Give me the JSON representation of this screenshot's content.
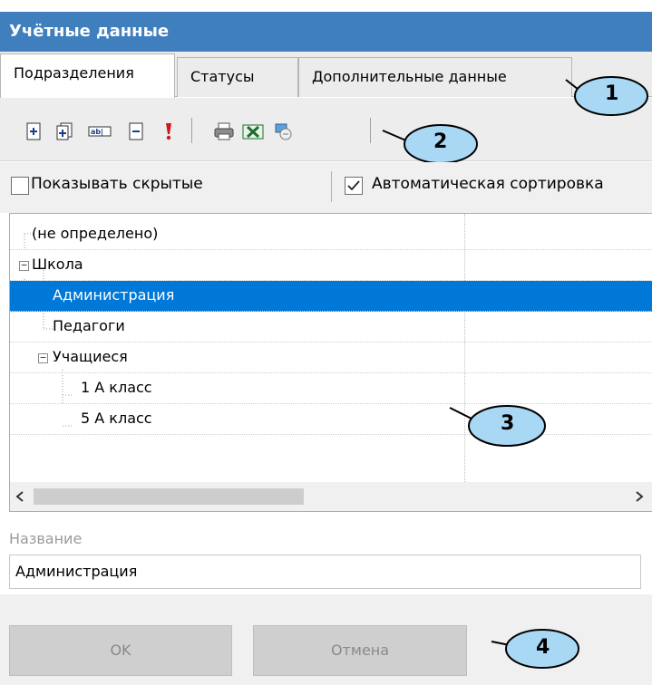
{
  "window": {
    "title": "Учётные данные"
  },
  "tabs": [
    {
      "label": "Подразделения",
      "active": true
    },
    {
      "label": "Статусы",
      "active": false
    },
    {
      "label": "Дополнительные данные",
      "active": false
    }
  ],
  "toolbar": {
    "icons": [
      "add-icon",
      "add-child-icon",
      "rename-icon",
      "delete-icon",
      "alert-icon",
      "print-icon",
      "excel-export-icon",
      "import-icon"
    ]
  },
  "options": {
    "show_hidden_label": "Показывать скрытые",
    "show_hidden_checked": false,
    "auto_sort_label": "Автоматическая сортировка",
    "auto_sort_checked": true
  },
  "tree": {
    "rows": [
      {
        "label": "(не определено)",
        "level": 0,
        "expandable": false,
        "selected": false
      },
      {
        "label": "Школа",
        "level": 0,
        "expandable": true,
        "selected": false
      },
      {
        "label": "Администрация",
        "level": 1,
        "expandable": false,
        "selected": true
      },
      {
        "label": "Педагоги",
        "level": 1,
        "expandable": false,
        "selected": false
      },
      {
        "label": "Учащиеся",
        "level": 1,
        "expandable": true,
        "selected": false
      },
      {
        "label": "1 А класс",
        "level": 2,
        "expandable": false,
        "selected": false
      },
      {
        "label": "5 А класс",
        "level": 2,
        "expandable": false,
        "selected": false
      }
    ]
  },
  "name_field": {
    "label": "Название",
    "value": "Администрация"
  },
  "buttons": {
    "ok": "OK",
    "cancel": "Отмена"
  },
  "callouts": [
    "1",
    "2",
    "3",
    "4"
  ],
  "colors": {
    "title_bar": "#3f7fbe",
    "selection": "#0078d7",
    "callout_fill": "#a9d8f5"
  }
}
